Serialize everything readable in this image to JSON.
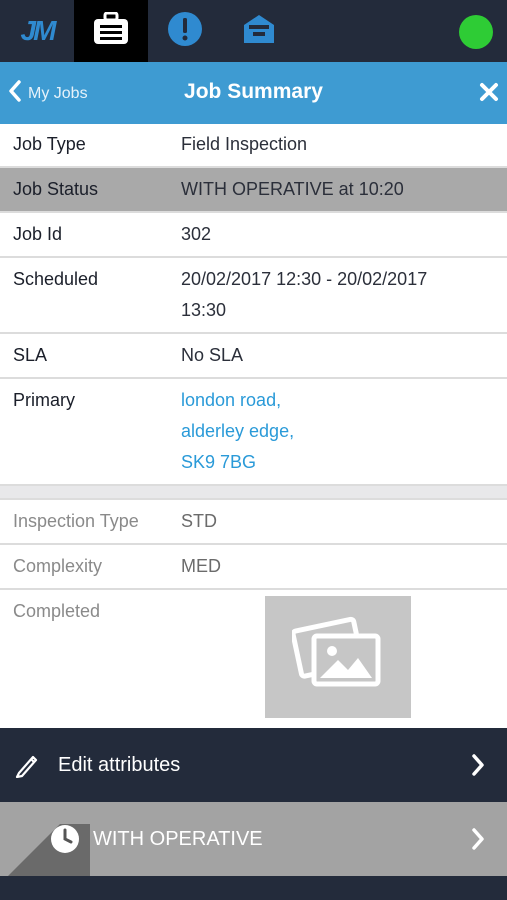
{
  "topbar": {
    "logo_text": "JM",
    "tabs": [
      "logo",
      "jobs-briefcase-icon",
      "alert-icon",
      "inbox-icon"
    ],
    "status_color": "#2ecc35"
  },
  "header": {
    "back_label": "My Jobs",
    "title": "Job Summary"
  },
  "details": {
    "job_type": {
      "label": "Job Type",
      "value": "Field Inspection"
    },
    "job_status": {
      "label": "Job Status",
      "value": "WITH OPERATIVE at 10:20"
    },
    "job_id": {
      "label": "Job Id",
      "value": "302"
    },
    "scheduled": {
      "label": "Scheduled",
      "value": "20/02/2017 12:30 - 20/02/2017 13:30"
    },
    "sla": {
      "label": "SLA",
      "value": "No SLA"
    },
    "primary": {
      "label": "Primary",
      "address": [
        "london road,",
        "alderley edge,",
        "SK9 7BG"
      ]
    }
  },
  "attributes": {
    "inspection_type": {
      "label": "Inspection Type",
      "value": "STD"
    },
    "complexity": {
      "label": "Complexity",
      "value": "MED"
    },
    "completed": {
      "label": "Completed"
    }
  },
  "actions": {
    "edit_label": "Edit attributes",
    "status_label": "WITH OPERATIVE"
  }
}
